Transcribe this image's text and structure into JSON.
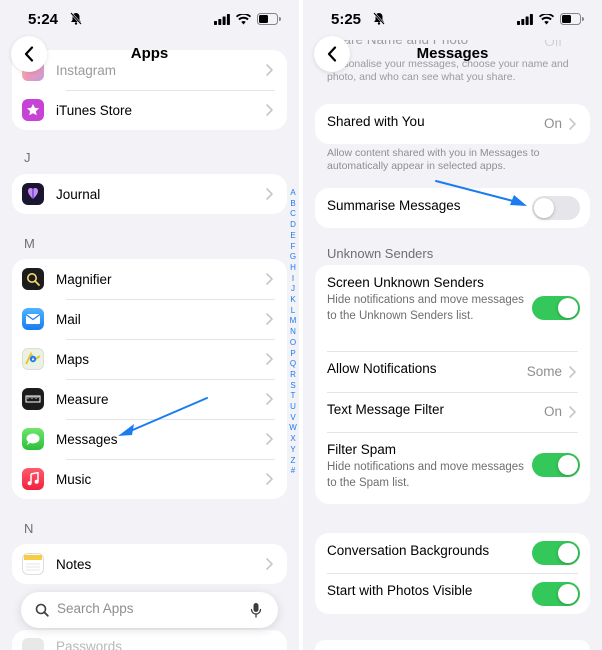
{
  "left": {
    "status": {
      "time": "5:24"
    },
    "nav": {
      "title": "Apps"
    },
    "groups": {
      "top": [
        {
          "label": "Instagram"
        },
        {
          "label": "iTunes Store"
        }
      ],
      "j": [
        {
          "label": "Journal"
        }
      ],
      "m": [
        {
          "label": "Magnifier"
        },
        {
          "label": "Mail"
        },
        {
          "label": "Maps"
        },
        {
          "label": "Measure"
        },
        {
          "label": "Messages"
        },
        {
          "label": "Music"
        }
      ],
      "n": [
        {
          "label": "Notes"
        }
      ],
      "p": [
        {
          "label": "Passwords"
        }
      ]
    },
    "sections": {
      "j": "J",
      "m": "M",
      "n": "N"
    },
    "index_letters": [
      "A",
      "B",
      "C",
      "D",
      "E",
      "F",
      "G",
      "H",
      "I",
      "J",
      "K",
      "L",
      "M",
      "N",
      "O",
      "P",
      "Q",
      "R",
      "S",
      "T",
      "U",
      "V",
      "W",
      "X",
      "Y",
      "Z",
      "#"
    ],
    "search": {
      "placeholder": "Search Apps"
    }
  },
  "right": {
    "status": {
      "time": "5:25"
    },
    "nav": {
      "title": "Messages"
    },
    "top_partial": {
      "label": "Share Name and Photo",
      "value": "Off",
      "desc": "Personalise your messages, choose your name and photo, and who can see what you share."
    },
    "shared_with_you": {
      "label": "Shared with You",
      "value": "On",
      "footnote": "Allow content shared with you in Messages to automatically appear in selected apps."
    },
    "summarise": {
      "label": "Summarise Messages",
      "on": false
    },
    "unknown_senders": {
      "header": "Unknown Senders",
      "screen": {
        "label": "Screen Unknown Senders",
        "desc": "Hide notifications and move messages to the Unknown Senders list.",
        "on": true
      },
      "allow_notifications": {
        "label": "Allow Notifications",
        "value": "Some"
      },
      "text_filter": {
        "label": "Text Message Filter",
        "value": "On"
      },
      "filter_spam": {
        "label": "Filter Spam",
        "desc": "Hide notifications and move messages to the Spam list.",
        "on": true
      }
    },
    "conversation": {
      "backgrounds": {
        "label": "Conversation Backgrounds",
        "on": true
      },
      "photos_visible": {
        "label": "Start with Photos Visible",
        "on": true
      }
    }
  },
  "colors": {
    "accent_blue": "#1b7cf2",
    "toggle_on": "#34c759",
    "toggle_off": "#e5e5ea",
    "background": "#f2f2f7"
  }
}
